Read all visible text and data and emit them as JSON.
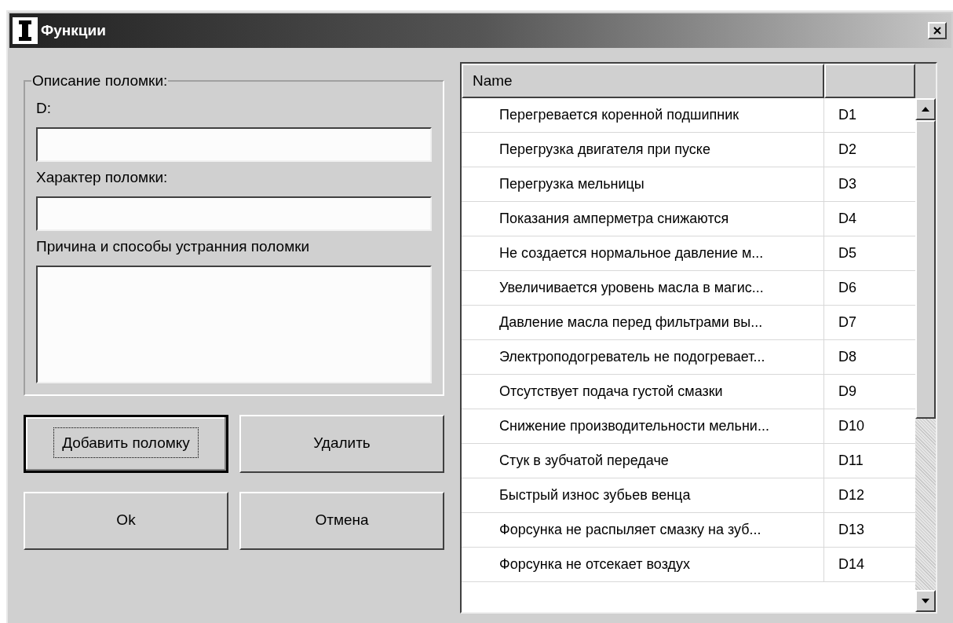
{
  "window": {
    "title": "Функции"
  },
  "group": {
    "title": "Описание поломки:",
    "fields": [
      {
        "label": "D:",
        "kind": "line"
      },
      {
        "label": "Характер поломки:",
        "kind": "line"
      },
      {
        "label": "Причина и способы устранния поломки",
        "kind": "multiline"
      }
    ]
  },
  "buttons": [
    {
      "label": "Добавить поломку",
      "focused": true
    },
    {
      "label": "Удалить",
      "focused": false
    },
    {
      "label": "Ok",
      "focused": false
    },
    {
      "label": "Отмена",
      "focused": false
    }
  ],
  "table": {
    "columns": [
      "Name"
    ],
    "rows": [
      {
        "name": "Перегревается коренной подшипник",
        "code": "D1"
      },
      {
        "name": "Перегрузка двигателя при пуске",
        "code": "D2"
      },
      {
        "name": "Перегрузка мельницы",
        "code": "D3"
      },
      {
        "name": "Показания амперметра снижаются",
        "code": "D4"
      },
      {
        "name": "Не создается нормальное давление м...",
        "code": "D5"
      },
      {
        "name": "Увеличивается уровень масла в магис...",
        "code": "D6"
      },
      {
        "name": "Давление масла перед фильтрами вы...",
        "code": "D7"
      },
      {
        "name": "Электроподогреватель не подогревает...",
        "code": "D8"
      },
      {
        "name": "Отсутствует подача густой смазки",
        "code": "D9"
      },
      {
        "name": "Снижение производительности мельни...",
        "code": "D10"
      },
      {
        "name": "Стук в зубчатой передаче",
        "code": "D11"
      },
      {
        "name": "Быстрый износ зубьев венца",
        "code": "D12"
      },
      {
        "name": "Форсунка не распыляет смазку на зуб...",
        "code": "D13"
      },
      {
        "name": "Форсунка не отсекает воздух",
        "code": "D14"
      }
    ]
  }
}
